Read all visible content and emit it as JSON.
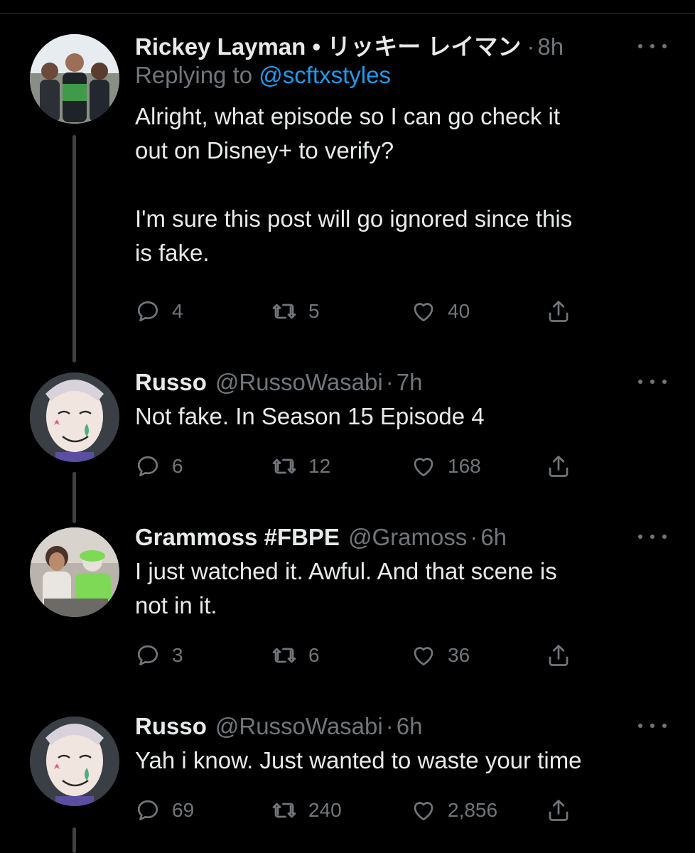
{
  "tweets": [
    {
      "name": "Rickey Layman • リッキー レイマン",
      "handle": "",
      "time": "8h",
      "replying_prefix": "Replying to ",
      "replying_to": "@scftxstyles",
      "text": "Alright, what episode so I can go check it\nout on Disney+ to verify?\n\nI'm sure this post will go ignored since this\nis fake.",
      "replies": "4",
      "retweets": "5",
      "likes": "40"
    },
    {
      "name": "Russo",
      "handle": "@RussoWasabi",
      "time": "7h",
      "text": "Not fake. In Season 15 Episode 4",
      "replies": "6",
      "retweets": "12",
      "likes": "168"
    },
    {
      "name": "Grammoss #FBPE",
      "handle": "@Gramoss",
      "time": "6h",
      "text": "I just watched it. Awful. And that scene is\nnot in it.",
      "replies": "3",
      "retweets": "6",
      "likes": "36"
    },
    {
      "name": "Russo",
      "handle": "@RussoWasabi",
      "time": "6h",
      "text": "Yah i know. Just wanted to waste your time",
      "replies": "69",
      "retweets": "240",
      "likes": "2,856"
    }
  ],
  "separator_dot": "·",
  "icons": {
    "reply": "reply-icon",
    "retweet": "retweet-icon",
    "like": "heart-icon",
    "share": "share-icon",
    "more": "more-icon"
  },
  "colors": {
    "background": "#000000",
    "text": "#e7e9ea",
    "secondary": "#71767b",
    "link": "#1d9bf0",
    "thread_line": "#3e4144"
  }
}
